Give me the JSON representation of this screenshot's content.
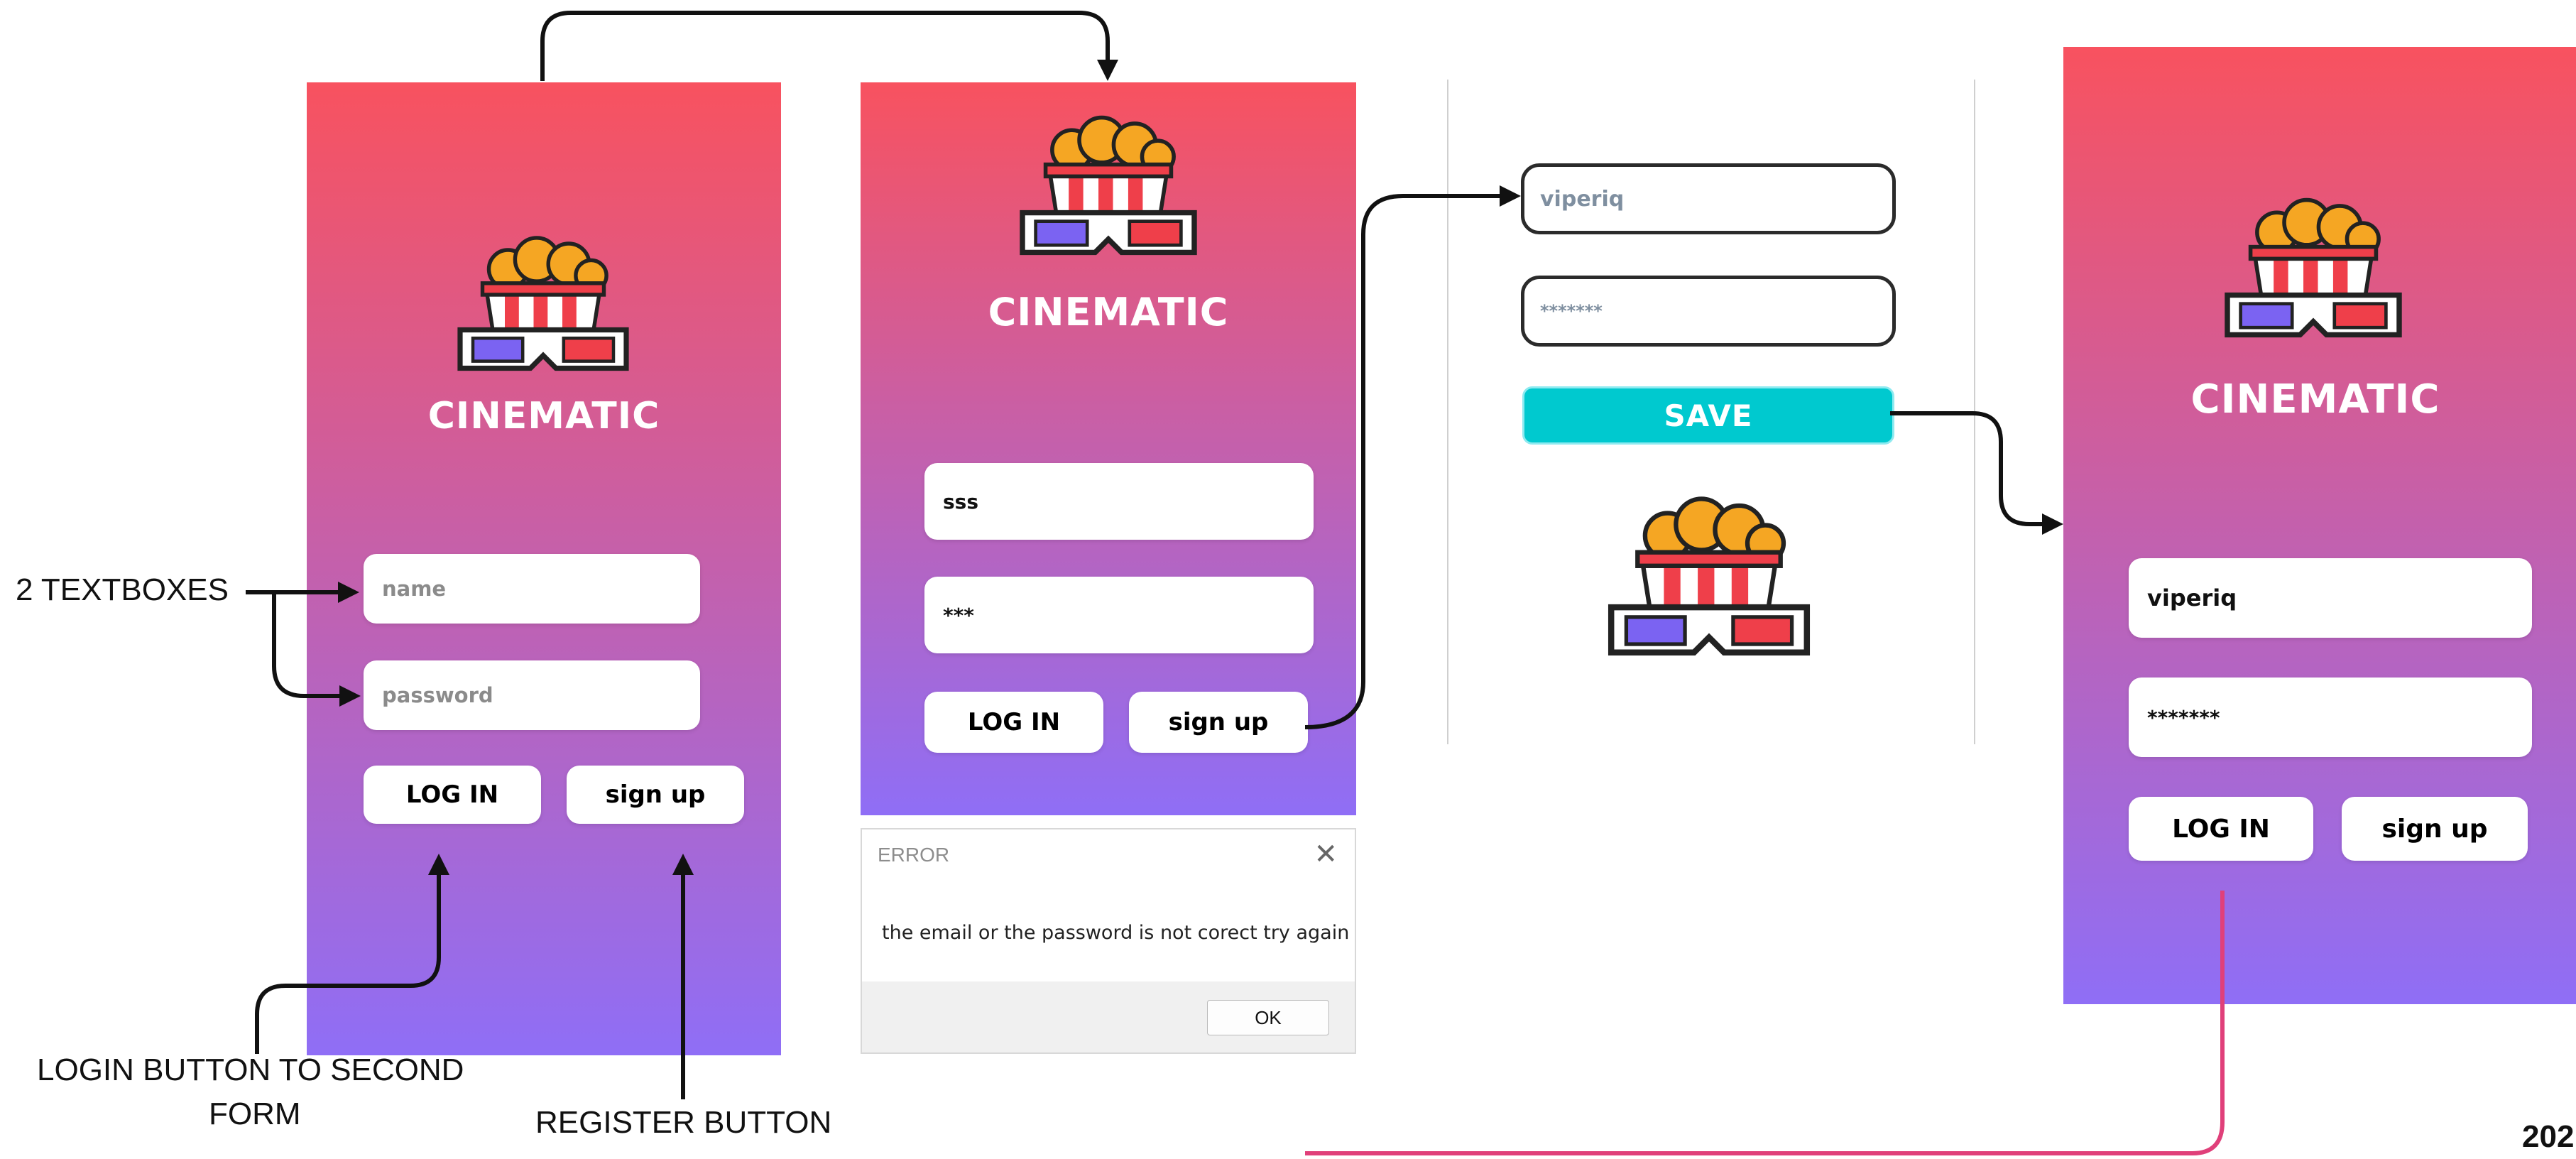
{
  "brand_name": "CINEMATIC",
  "colors": {
    "gradient_top": "#f8525f",
    "gradient_bottom": "#8f6ef6",
    "save_button": "#00c9cf",
    "flow_arrow_pink": "#e0407a"
  },
  "icons": [
    "popcorn-3d-glasses-logo"
  ],
  "screen1": {
    "name_placeholder": "name",
    "password_placeholder": "password",
    "login_label": "LOG IN",
    "signup_label": "sign up"
  },
  "screen2": {
    "name_value": "sss",
    "password_value": "***",
    "login_label": "LOG IN",
    "signup_label": "sign up"
  },
  "error_dialog": {
    "title": "ERROR",
    "close_glyph": "✕",
    "message": "the email or the password is not corect try again",
    "ok_label": "OK"
  },
  "signup_form": {
    "name_value": "viperiq",
    "password_value": "*******",
    "save_label": "SAVE"
  },
  "screen3": {
    "name_value": "viperiq",
    "password_value": "*******",
    "login_label": "LOG IN",
    "signup_label": "sign up"
  },
  "annotations": {
    "textboxes": "2 TEXTBOXES",
    "login_line1": "LOGIN BUTTON TO SECOND",
    "login_line2": "FORM",
    "register": "REGISTER BUTTON",
    "corner_text": "202"
  }
}
